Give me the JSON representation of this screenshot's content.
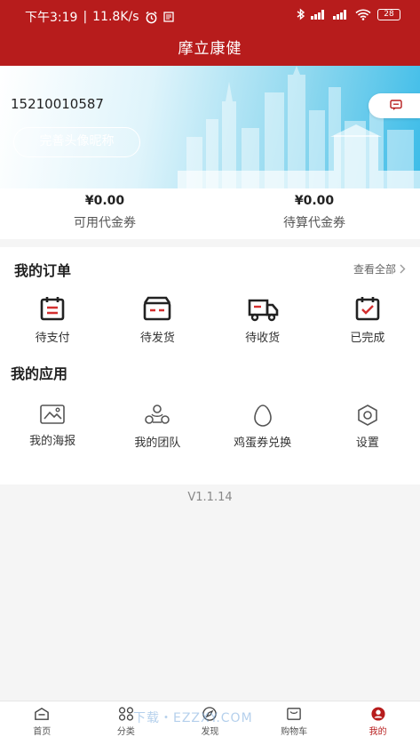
{
  "status_bar": {
    "time": "下午3:19",
    "speed": "11.8K/s",
    "battery": "28"
  },
  "app_title": "摩立康健",
  "profile": {
    "phone": "15210010587",
    "complete_profile_label": "完善头像昵称"
  },
  "vouchers": [
    {
      "amount": "¥0.00",
      "label": "可用代金券"
    },
    {
      "amount": "¥0.00",
      "label": "待算代金券"
    }
  ],
  "orders": {
    "title": "我的订单",
    "view_all": "查看全部",
    "items": [
      {
        "label": "待支付",
        "icon": "payment-icon"
      },
      {
        "label": "待发货",
        "icon": "wallet-icon"
      },
      {
        "label": "待收货",
        "icon": "truck-icon"
      },
      {
        "label": "已完成",
        "icon": "checklist-icon"
      }
    ]
  },
  "apps": {
    "title": "我的应用",
    "items": [
      {
        "label": "我的海报",
        "icon": "poster-icon"
      },
      {
        "label": "我的团队",
        "icon": "team-icon"
      },
      {
        "label": "鸡蛋券兑换",
        "icon": "egg-icon"
      },
      {
        "label": "设置",
        "icon": "settings-icon"
      }
    ]
  },
  "version": "V1.1.14",
  "tabs": [
    {
      "label": "首页",
      "icon": "home-icon"
    },
    {
      "label": "分类",
      "icon": "category-icon"
    },
    {
      "label": "发现",
      "icon": "compass-icon"
    },
    {
      "label": "购物车",
      "icon": "cart-icon"
    },
    {
      "label": "我的",
      "icon": "profile-icon",
      "active": true
    }
  ],
  "watermark": "下载・EZZXY.COM",
  "colors": {
    "brand_red": "#b71c1c",
    "banner_blue": "#3cbce8"
  }
}
